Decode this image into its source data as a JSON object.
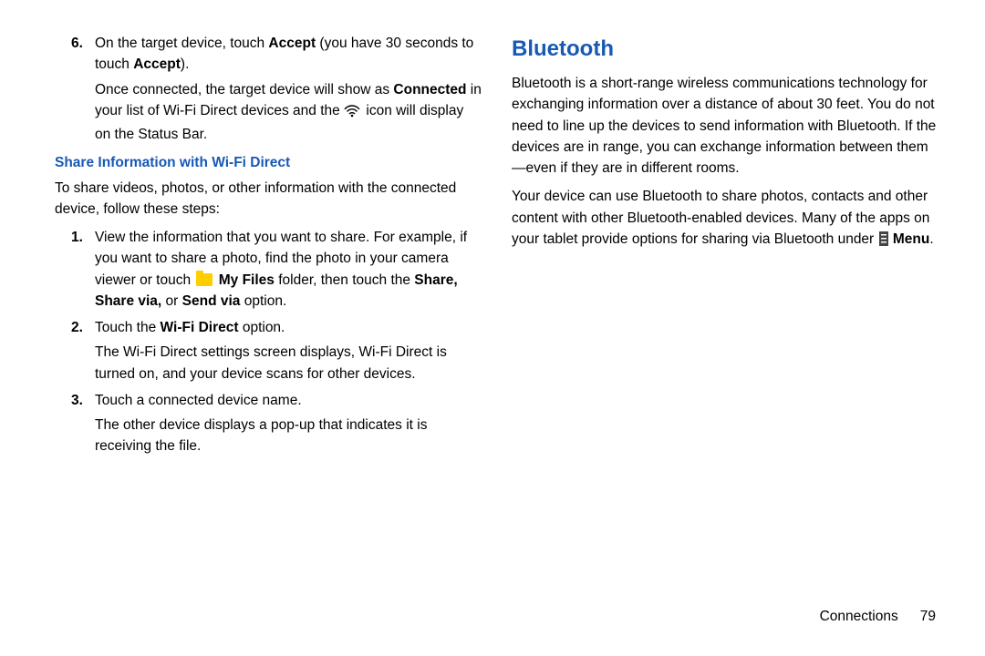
{
  "left": {
    "step6_num": "6.",
    "step6_t1": "On the target device, touch ",
    "step6_accept1": "Accept",
    "step6_t2": " (you have 30 seconds to touch ",
    "step6_accept2": "Accept",
    "step6_t3": ").",
    "step6_cont_t1": "Once connected, the target device will show as ",
    "step6_cont_bold": "Connected",
    "step6_cont_t2": " in your list of Wi-Fi Direct devices and the ",
    "step6_cont_t3": " icon will display on the Status Bar.",
    "sub_heading": "Share Information with Wi-Fi Direct",
    "share_intro": "To share videos, photos, or other information with the connected device, follow these steps:",
    "s1_num": "1.",
    "s1_t1": "View the information that you want to share. For example, if you want to share a photo, find the photo in your camera viewer or touch ",
    "s1_myfiles": "My Files",
    "s1_t2": " folder, then touch the ",
    "s1_bold2": "Share, Share via,",
    "s1_t3": " or ",
    "s1_bold3": "Send via",
    "s1_t4": " option.",
    "s2_num": "2.",
    "s2_t1": "Touch the ",
    "s2_bold": "Wi-Fi Direct",
    "s2_t2": " option.",
    "s2_cont": "The Wi-Fi Direct settings screen displays, Wi-Fi Direct is turned on, and your device scans for other devices.",
    "s3_num": "3.",
    "s3_t1": "Touch a connected device name.",
    "s3_cont": "The other device displays a pop-up that indicates it is receiving the file."
  },
  "right": {
    "heading": "Bluetooth",
    "p1": "Bluetooth is a short-range wireless communications technology for exchanging information over a distance of about 30 feet. You do not need to line up the devices to send information with Bluetooth. If the devices are in range, you can exchange information between them—even if they are in different rooms.",
    "p2_t1": "Your device can use Bluetooth to share photos, contacts and other content with other Bluetooth-enabled devices. Many of the apps on your tablet provide options for sharing via Bluetooth under ",
    "p2_menu": "Menu",
    "p2_t2": ".",
    "footer_label": "Connections",
    "footer_page": "79"
  }
}
